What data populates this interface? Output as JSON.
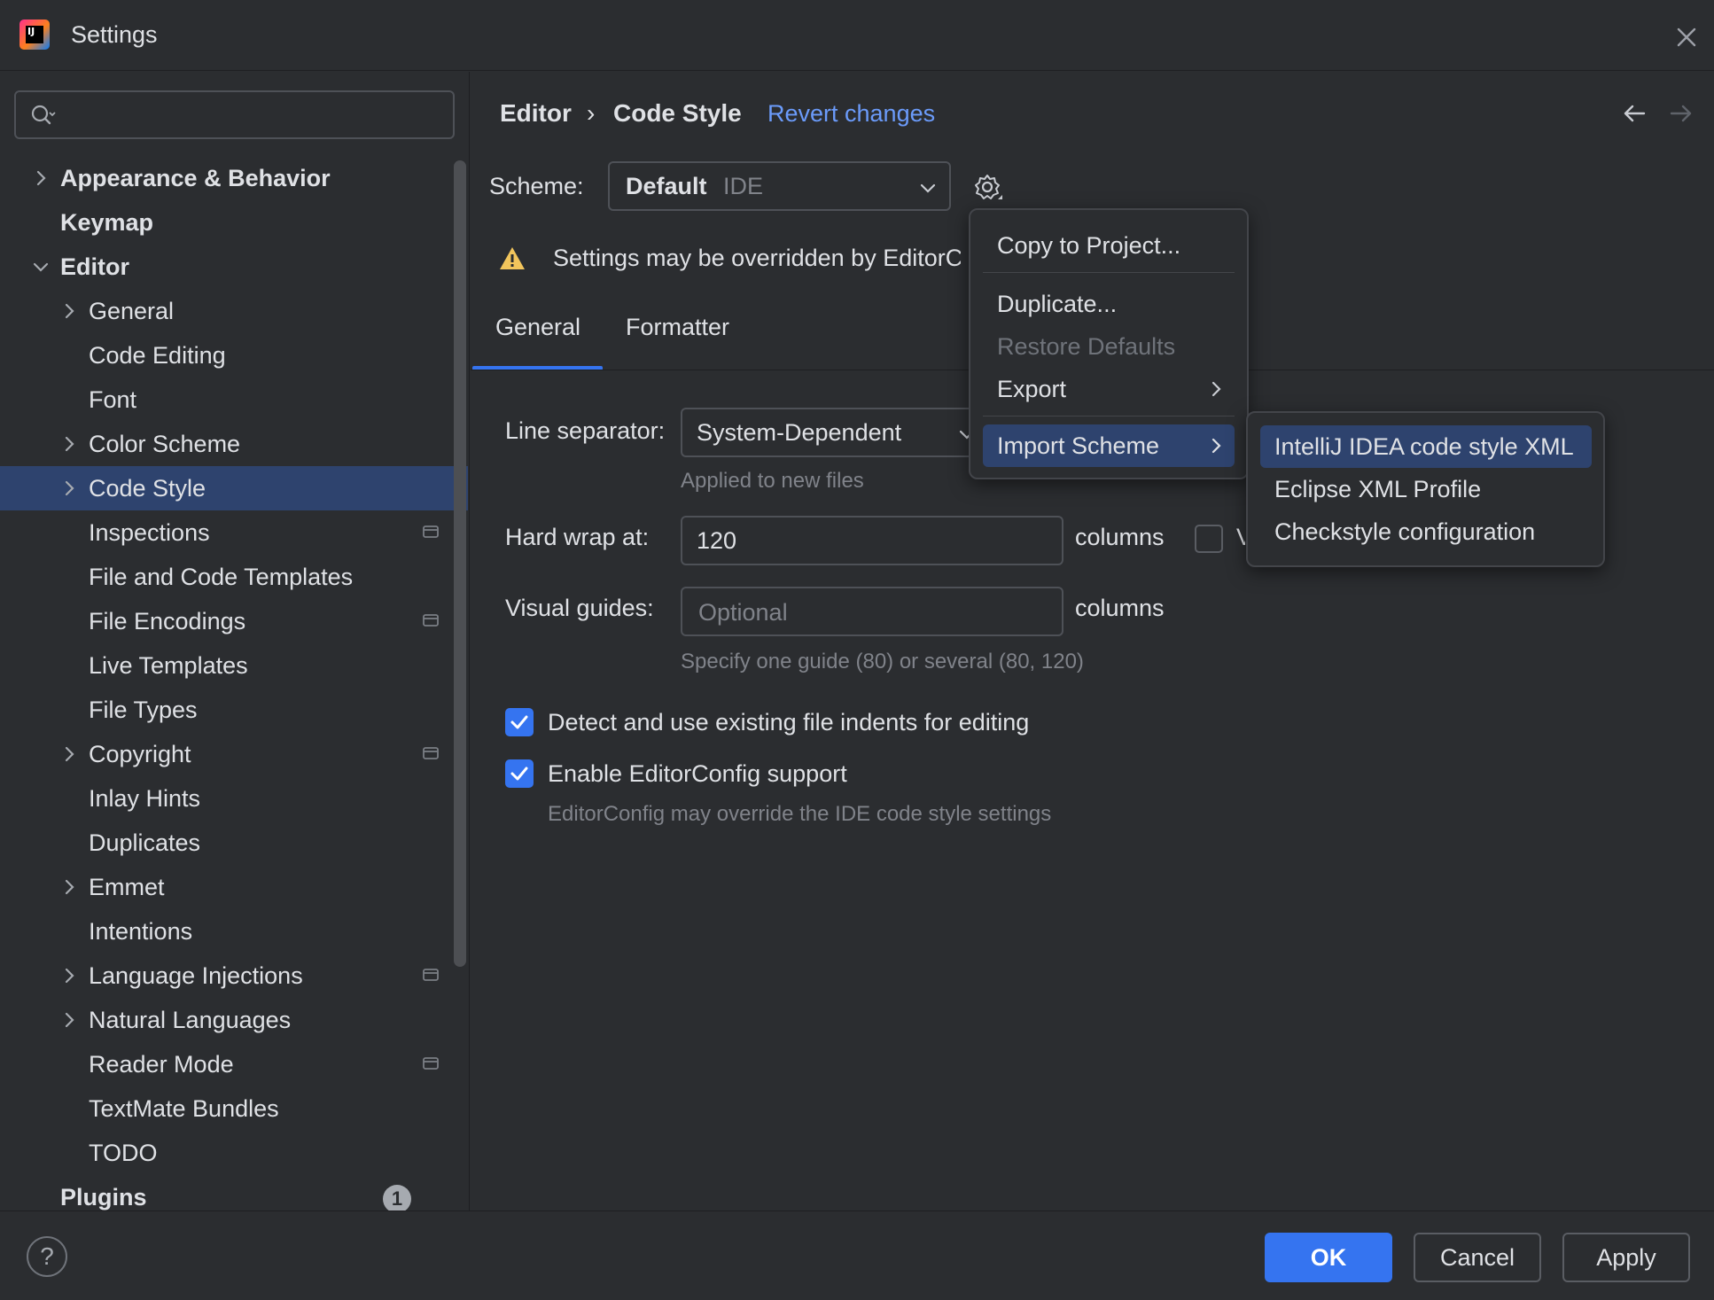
{
  "window": {
    "title": "Settings",
    "logo_text": "IJ"
  },
  "sidebar": {
    "search_placeholder": "",
    "items": [
      {
        "label": "Appearance & Behavior",
        "bold": true,
        "expandable": true,
        "expanded": false,
        "level": 0
      },
      {
        "label": "Keymap",
        "bold": true,
        "expandable": false,
        "level": 0
      },
      {
        "label": "Editor",
        "bold": true,
        "expandable": true,
        "expanded": true,
        "level": 0
      },
      {
        "label": "General",
        "expandable": true,
        "level": 1
      },
      {
        "label": "Code Editing",
        "level": 1
      },
      {
        "label": "Font",
        "level": 1
      },
      {
        "label": "Color Scheme",
        "expandable": true,
        "level": 1
      },
      {
        "label": "Code Style",
        "expandable": true,
        "level": 1,
        "selected": true
      },
      {
        "label": "Inspections",
        "level": 1,
        "project_icon": true
      },
      {
        "label": "File and Code Templates",
        "level": 1
      },
      {
        "label": "File Encodings",
        "level": 1,
        "project_icon": true
      },
      {
        "label": "Live Templates",
        "level": 1
      },
      {
        "label": "File Types",
        "level": 1
      },
      {
        "label": "Copyright",
        "expandable": true,
        "level": 1,
        "project_icon": true
      },
      {
        "label": "Inlay Hints",
        "level": 1
      },
      {
        "label": "Duplicates",
        "level": 1
      },
      {
        "label": "Emmet",
        "expandable": true,
        "level": 1
      },
      {
        "label": "Intentions",
        "level": 1
      },
      {
        "label": "Language Injections",
        "expandable": true,
        "level": 1,
        "project_icon": true
      },
      {
        "label": "Natural Languages",
        "expandable": true,
        "level": 1
      },
      {
        "label": "Reader Mode",
        "level": 1,
        "project_icon": true
      },
      {
        "label": "TextMate Bundles",
        "level": 1
      },
      {
        "label": "TODO",
        "level": 1
      },
      {
        "label": "Plugins",
        "bold": true,
        "level": 0,
        "badge": "1"
      }
    ]
  },
  "breadcrumb": {
    "parent": "Editor",
    "separator": "›",
    "current": "Code Style",
    "revert_label": "Revert changes"
  },
  "scheme": {
    "label": "Scheme:",
    "value": "Default",
    "qualifier": "IDE"
  },
  "warning": {
    "text": "Settings may be overridden by EditorC"
  },
  "tabs": [
    {
      "label": "General",
      "active": true
    },
    {
      "label": "Formatter",
      "active": false
    }
  ],
  "form": {
    "line_separator_label": "Line separator:",
    "line_separator_value": "System-Dependent",
    "line_separator_hint": "Applied to new files",
    "hard_wrap_label": "Hard wrap at:",
    "hard_wrap_value": "120",
    "hard_wrap_unit": "columns",
    "hard_wrap_checkbox_label": "V",
    "visual_guides_label": "Visual guides:",
    "visual_guides_placeholder": "Optional",
    "visual_guides_unit": "columns",
    "visual_guides_hint": "Specify one guide (80) or several (80, 120)",
    "detect_indents_label": "Detect and use existing file indents for editing",
    "editorconfig_label": "Enable EditorConfig support",
    "editorconfig_hint": "EditorConfig may override the IDE code style settings"
  },
  "scheme_menu": {
    "items": [
      {
        "label": "Copy to Project...",
        "enabled": true
      },
      {
        "label": "Duplicate...",
        "enabled": true
      },
      {
        "label": "Restore Defaults",
        "enabled": false
      },
      {
        "label": "Export",
        "enabled": true,
        "submenu": true
      },
      {
        "label": "Import Scheme",
        "enabled": true,
        "submenu": true,
        "highlighted": true
      }
    ]
  },
  "import_submenu": {
    "items": [
      {
        "label": "IntelliJ IDEA code style XML",
        "highlighted": true
      },
      {
        "label": "Eclipse XML Profile"
      },
      {
        "label": "Checkstyle configuration"
      }
    ]
  },
  "footer": {
    "help_label": "?",
    "ok_label": "OK",
    "cancel_label": "Cancel",
    "apply_label": "Apply"
  },
  "colors": {
    "accent": "#3574f0",
    "link": "#6b9bfa",
    "selection": "#2e436e",
    "warning": "#f2c55c",
    "background": "#2b2d30"
  }
}
